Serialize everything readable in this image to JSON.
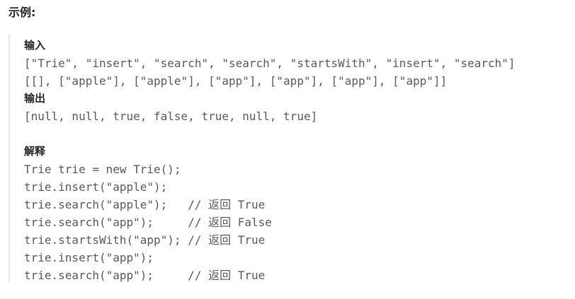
{
  "heading": "示例:",
  "input_label": "输入",
  "input_lines": [
    "[\"Trie\", \"insert\", \"search\", \"search\", \"startsWith\", \"insert\", \"search\"]",
    "[[], [\"apple\"], [\"apple\"], [\"app\"], [\"app\"], [\"app\"], [\"app\"]]"
  ],
  "output_label": "输出",
  "output_line": "[null, null, true, false, true, null, true]",
  "explain_label": "解释",
  "explain_lines": [
    "Trie trie = new Trie();",
    "trie.insert(\"apple\");",
    "trie.search(\"apple\");   // 返回 True",
    "trie.search(\"app\");     // 返回 False",
    "trie.startsWith(\"app\"); // 返回 True",
    "trie.insert(\"app\");",
    "trie.search(\"app\");     // 返回 True"
  ]
}
